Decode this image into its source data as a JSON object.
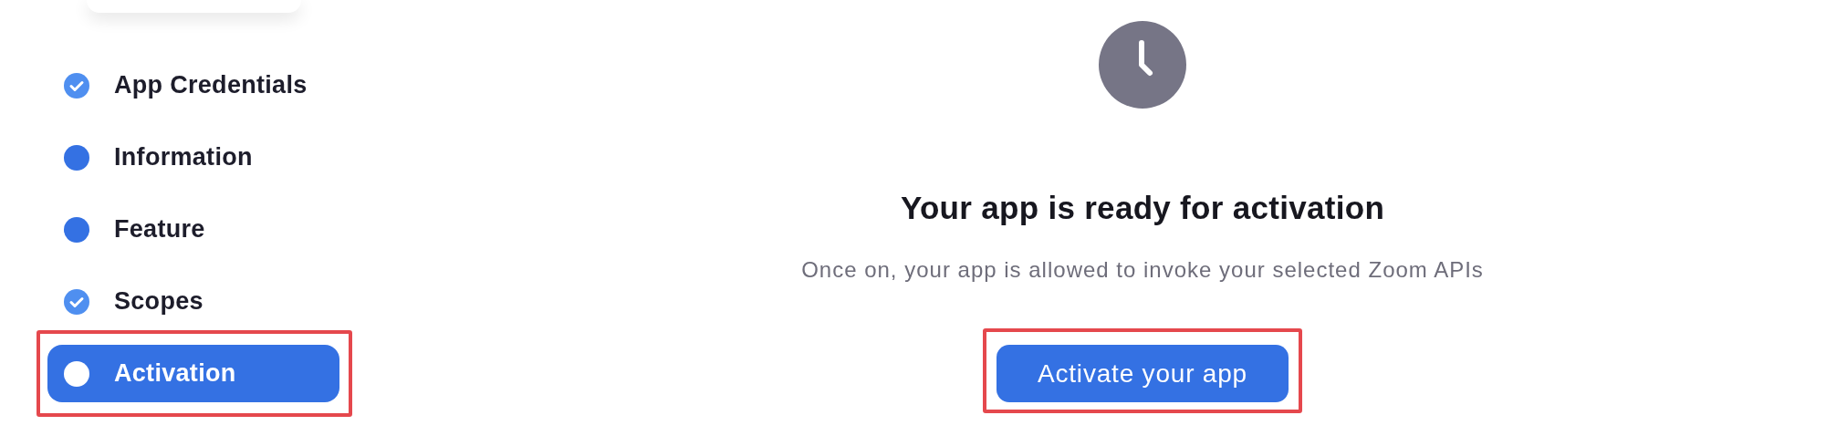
{
  "steps": [
    {
      "label": "App Credentials",
      "completed": true,
      "selected": false,
      "highlighted": false
    },
    {
      "label": "Information",
      "completed": false,
      "selected": false,
      "highlighted": false
    },
    {
      "label": "Feature",
      "completed": false,
      "selected": false,
      "highlighted": false
    },
    {
      "label": "Scopes",
      "completed": true,
      "selected": false,
      "highlighted": false
    },
    {
      "label": "Activation",
      "completed": false,
      "selected": true,
      "highlighted": true
    }
  ],
  "activation": {
    "title": "Your app is ready for activation",
    "description": "Once on, your app is allowed to invoke your selected Zoom APIs",
    "button": {
      "label": "Activate your app",
      "highlighted": true
    }
  }
}
